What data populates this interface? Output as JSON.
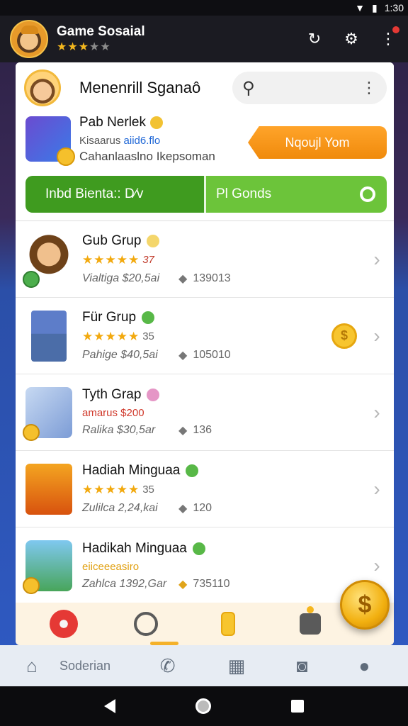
{
  "status_bar": {
    "time": "1:30",
    "wifi_icon": "wifi-icon",
    "battery_icon": "battery-icon"
  },
  "header": {
    "title": "Game Sosaial",
    "stars_filled": "★★★",
    "stars_empty": "★★",
    "rating": 3
  },
  "profile": {
    "name": "Menenrill Sganaô",
    "search_placeholder": "",
    "search_icon": "search-icon",
    "more_icon": "more-vert-icon"
  },
  "promo": {
    "title": "Pab Nerlek",
    "sub1_prefix": "Kisaarus ",
    "sub1_highlight": "aiid6.flo",
    "sub2": "Cahanlaaslno Ikepsoman",
    "button_label": "Nqoujl Yom"
  },
  "tabs": {
    "left_label": "Inbd Bienta:: D⁄v",
    "right_label": "Pl Gonds"
  },
  "groups": [
    {
      "name": "Gub Grup",
      "stars": "★★★★★",
      "rating_text": "37",
      "detail": "Vialtiga  $20,5ai",
      "count": "139013"
    },
    {
      "name": "Für Grup",
      "stars": "★★★★★",
      "rating_text": "35",
      "detail": "Pahige  $40,5ai",
      "count": "105010"
    },
    {
      "name": "Tyth Grap",
      "tagline": "amarus $200",
      "detail": "Ralika  $30,5ar",
      "count": "136"
    },
    {
      "name": "Hadiah Minguaa",
      "stars": "★★★★★",
      "rating_text": "35",
      "detail": "Zulilca  2,24,kai",
      "count": "120"
    },
    {
      "name": "Hadikah Minguaa",
      "tagline": "eiiceeeasiro",
      "detail": "Zahlca  1392,Gar",
      "count": "735110"
    }
  ],
  "bottom_nav": {
    "label": "Soderian"
  },
  "colors": {
    "accent_orange": "#f39b1c",
    "tab_green_dark": "#3f9b1f",
    "tab_green_light": "#6cc43a",
    "star_gold": "#f2a90e"
  }
}
